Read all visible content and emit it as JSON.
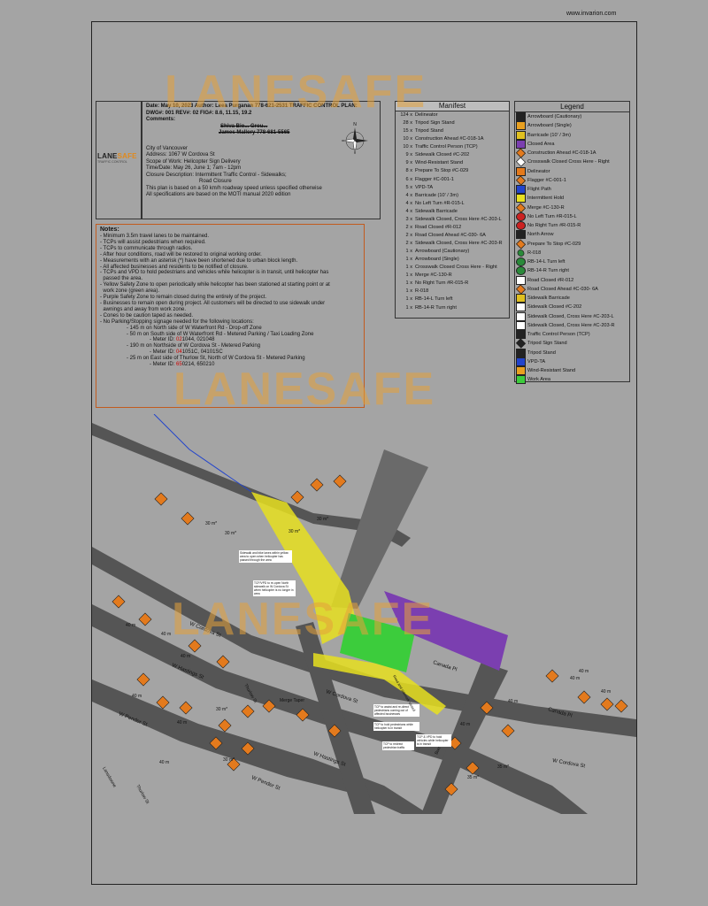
{
  "site_url": "www.invarion.com",
  "watermark": "LANESAFE",
  "logo": {
    "word_a": "LANE",
    "word_b": "SAFE",
    "sub": "TRAFFIC CONTROL"
  },
  "compass_letter": "N",
  "header": {
    "line1": "Date: May 10, 2023 Author: Leea Purganan 778-621-2531 TRAFFIC CONTROL PLAN:",
    "line2": "DWG#: 001 REV#: 02 FIG#: 8.6, 11.15, 19.2",
    "comments": "Comments:",
    "struck1": "Shiva Bio... Grou...",
    "struck2": "James Mallory 778-681-5565",
    "city": "City of Vancouver",
    "address": "Address: 1067 W Cordova St",
    "scope": "Scope of Work: Helicopter Sign Delivery",
    "time": "Time/Date: May 26, June 1; 7am - 12pm",
    "closure": "Closure Description: Intermittent Traffic Control - Sidewalks;",
    "closure2": "Road Closure",
    "plan1": "This plan is based on a 50 km/h roadway speed unless specified otherwise",
    "plan2": "All specifications are based on the MOTI manual 2020 edition"
  },
  "notes": {
    "title": "Notes:",
    "items": [
      "- Minimum 3.5m travel lanes to be maintained.",
      "- TCPs will assist pedestrians when required.",
      "- TCPs to communicate through radios.",
      "- After hour conditions, road will be restored to original working order.",
      "- Measurements with an asterisk (*) have been shortened due to urban block length.",
      "- All affected businesses and residents to be notified of closure.",
      "- TCPs and VPD to hold pedestrians and vehicles while helicopter is in transit, until helicopter has",
      "  passed the area.",
      "- Yellow Safety Zone to open periodically while helicopter has been stationed at starting point or at",
      "  work zone (green area).",
      "- Purple Safety Zone to remain closed during the entirely of the project.",
      "- Businesses to remain open during project. All customers will be directed to use sidewalk under",
      "  awnings and away from work zone.",
      "- Cones to be caution taped as needed.",
      "- No Parking/Stopping signage needed for the following locations:"
    ],
    "parking": [
      {
        "text": "- 145 m on North side of W Waterfront Rd - Drop-off Zone",
        "meter": "",
        "meter_red": ""
      },
      {
        "text": "- 50 m on South side of W Waterfront Rd - Metered Parking / Taxi Loading Zone",
        "meter": "- Meter ID: ",
        "meter_red": "02",
        "meter_rest": "1044, 021048"
      },
      {
        "text": "- 190 m on Northside of W Cordova St - Metered Parking",
        "meter": "- Meter ID: ",
        "meter_red": "04",
        "meter_rest": "1051C, 04101SC"
      },
      {
        "text": "- 25 m on East side of Thurlow St, North of W Cordova St - Metered Parking",
        "meter": "- Meter ID: ",
        "meter_red": "65",
        "meter_rest": "0214, 650210"
      }
    ]
  },
  "manifest": {
    "title": "Manifest",
    "rows": [
      {
        "q": "124 x",
        "item": "Delineator"
      },
      {
        "q": "28 x",
        "item": "Tripod Sign Stand"
      },
      {
        "q": "15 x",
        "item": "Tripod Stand"
      },
      {
        "q": "10 x",
        "item": "Construction Ahead #C-018-1A"
      },
      {
        "q": "10 x",
        "item": "Traffic Control Person (TCP)"
      },
      {
        "q": "9 x",
        "item": "Sidewalk Closed #C-202"
      },
      {
        "q": "9 x",
        "item": "Wind-Resistant Stand"
      },
      {
        "q": "8 x",
        "item": "Prepare To Stop #C-029"
      },
      {
        "q": "6 x",
        "item": "Flagger #C-001-1"
      },
      {
        "q": "5 x",
        "item": "VPD-TA"
      },
      {
        "q": "4 x",
        "item": "Barricade (10' / 3m)"
      },
      {
        "q": "4 x",
        "item": "No Left Turn #R-015-L"
      },
      {
        "q": "4 x",
        "item": "Sidewalk Barricade"
      },
      {
        "q": "3 x",
        "item": "Sidewalk Closed, Cross Here #C-203-L"
      },
      {
        "q": "2 x",
        "item": "Road Closed #R-012"
      },
      {
        "q": "2 x",
        "item": "Road Closed Ahead #C-030- 6A"
      },
      {
        "q": "2 x",
        "item": "Sidewalk Closed, Cross Here #C-203-R"
      },
      {
        "q": "1 x",
        "item": "Arrowboard (Cautionary)"
      },
      {
        "q": "1 x",
        "item": "Arrowboard (Single)"
      },
      {
        "q": "1 x",
        "item": "Crosswalk Closed Cross Here - Right"
      },
      {
        "q": "1 x",
        "item": "Merge #C-130-R"
      },
      {
        "q": "1 x",
        "item": "No Right Turn #R-015-R"
      },
      {
        "q": "1 x",
        "item": "R-018"
      },
      {
        "q": "1 x",
        "item": "RB-14-L Turn left"
      },
      {
        "q": "1 x",
        "item": "RB-14-R Turn right"
      }
    ]
  },
  "legend": {
    "title": "Legend",
    "rows": [
      {
        "label": "Arrowboard (Cautionary)",
        "icon": "arrowboard-icon",
        "color": "#222222"
      },
      {
        "label": "Arrowboard (Single)",
        "icon": "arrowboard-single-icon",
        "color": "#e8a020"
      },
      {
        "label": "Barricade (10' / 3m)",
        "icon": "barricade-icon",
        "color": "#e0c020"
      },
      {
        "label": "Closed Area",
        "icon": "closed-area-icon",
        "color": "#7b3fb0"
      },
      {
        "label": "Construction Ahead #C-018-1A",
        "icon": "construction-sign-icon",
        "color": "#e37a1d"
      },
      {
        "label": "Crosswalk Closed Cross Here - Right",
        "icon": "crosswalk-sign-icon",
        "color": "#ffffff"
      },
      {
        "label": "Delineator",
        "icon": "delineator-icon",
        "color": "#e37a1d"
      },
      {
        "label": "Flagger #C-001-1",
        "icon": "flagger-sign-icon",
        "color": "#e37a1d"
      },
      {
        "label": "Flight Path",
        "icon": "flight-path-icon",
        "color": "#2244cc"
      },
      {
        "label": "Intermittent Hold",
        "icon": "intermittent-hold-icon",
        "color": "#e8e020"
      },
      {
        "label": "Merge #C-130-R",
        "icon": "merge-sign-icon",
        "color": "#e37a1d"
      },
      {
        "label": "No Left Turn #R-015-L",
        "icon": "no-left-turn-icon",
        "color": "#cc2222"
      },
      {
        "label": "No Right Turn #R-015-R",
        "icon": "no-right-turn-icon",
        "color": "#cc2222"
      },
      {
        "label": "North Arrow",
        "icon": "north-arrow-icon",
        "color": "#222222"
      },
      {
        "label": "Prepare To Stop #C-029",
        "icon": "prepare-stop-icon",
        "color": "#e37a1d"
      },
      {
        "label": "R-018",
        "icon": "r018-sign-icon",
        "color": "#2a8a3a"
      },
      {
        "label": "RB-14-L Turn left",
        "icon": "turn-left-icon",
        "color": "#2a8a3a"
      },
      {
        "label": "RB-14-R Turn right",
        "icon": "turn-right-icon",
        "color": "#2a8a3a"
      },
      {
        "label": "Road Closed #R-012",
        "icon": "road-closed-icon",
        "color": "#ffffff"
      },
      {
        "label": "Road Closed Ahead #C-030- 6A",
        "icon": "road-closed-ahead-icon",
        "color": "#e37a1d"
      },
      {
        "label": "Sidewalk Barricade",
        "icon": "sidewalk-barricade-icon",
        "color": "#e0c020"
      },
      {
        "label": "Sidewalk Closed #C-202",
        "icon": "sidewalk-closed-icon",
        "color": "#ffffff"
      },
      {
        "label": "Sidewalk Closed, Cross Here #C-203-L",
        "icon": "sidewalk-cross-left-icon",
        "color": "#ffffff"
      },
      {
        "label": "Sidewalk Closed, Cross Here #C-203-R",
        "icon": "sidewalk-cross-right-icon",
        "color": "#ffffff"
      },
      {
        "label": "Traffic Control Person (TCP)",
        "icon": "tcp-icon",
        "color": "#222222"
      },
      {
        "label": "Tripod Sign Stand",
        "icon": "tripod-sign-stand-icon",
        "color": "#222222"
      },
      {
        "label": "Tripod Stand",
        "icon": "tripod-stand-icon",
        "color": "#222222"
      },
      {
        "label": "VPD-TA",
        "icon": "vpd-icon",
        "color": "#2244cc"
      },
      {
        "label": "Wind-Resistant Stand",
        "icon": "wind-stand-icon",
        "color": "#e8a020"
      },
      {
        "label": "Work Area",
        "icon": "work-area-icon",
        "color": "#3ccc3c"
      }
    ]
  },
  "map": {
    "streets": {
      "cordova_nw": "W Cordova St",
      "cordova_mid": "W Cordova St",
      "cordova_se": "W Cordova St",
      "hastings_w": "W Hastings St",
      "hastings_e": "W Hastings St",
      "pender_w": "W Pender St",
      "pender_e": "W Pender St",
      "canada_pl": "Canada Pl",
      "canada_pl2": "Canada Pl",
      "thurlow": "Thurlow St",
      "thurlow2": "Thurlow St",
      "burrard": "Burrard St",
      "lansdowne": "Lansdowne"
    },
    "distance": "40 m",
    "distance30": "30 m*",
    "distance35": "35 m*",
    "merge_taper": "Merge Taper",
    "annotations": {
      "sidewalk": "Sidewalk and bike lanes within yellow area to open when helicopter has passed through the area",
      "tcp_vpd": "TCP/VPD to re-open North sidewalk on W Cordova St when helicopter is no longer in area",
      "tcp_assist": "TCP to assist and re-direct pedestrians coming out of affected businesses",
      "tcp_hold": "TCP to hold pedestrians while helicopter is in transit",
      "tcp_redirect": "TCP to redirect pedestrian traffic",
      "tcp_vpd_hold": "TCP & VPD to hold vehicles while helicopter is in transit",
      "red_note": "Road and sidewalk closed"
    }
  },
  "colors": {
    "background": "#a4a4a4",
    "watermark": "#e5a23b",
    "notes_border": "#c25b1e",
    "work_area": "#3ccc3c",
    "closed_area": "#7b3fb0",
    "intermittent_hold": "#e8e020",
    "flight_path": "#2244cc"
  }
}
